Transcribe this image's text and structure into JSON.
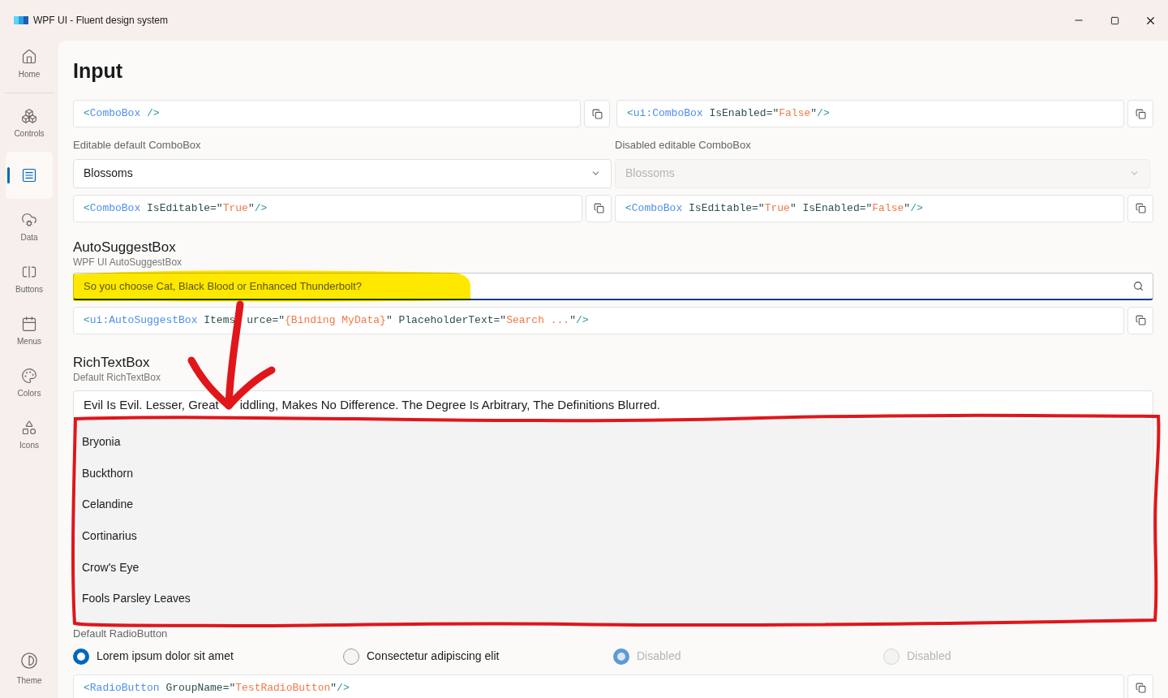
{
  "window": {
    "title": "WPF UI - Fluent design system"
  },
  "sidebar": {
    "items": [
      {
        "label": "Home",
        "selected": false
      },
      {
        "label": "Controls",
        "selected": false
      },
      {
        "selected": true
      },
      {
        "label": "Data",
        "selected": false
      },
      {
        "label": "Buttons",
        "selected": false
      },
      {
        "label": "Menus",
        "selected": false
      },
      {
        "label": "Colors",
        "selected": false
      },
      {
        "label": "Icons",
        "selected": false
      }
    ],
    "footer": {
      "label": "Theme"
    }
  },
  "page": {
    "title": "Input"
  },
  "combo_section": {
    "top_code": [
      [
        {
          "kind": "p",
          "text": "<"
        },
        {
          "kind": "t",
          "text": "ComboBox"
        },
        {
          "kind": "p",
          "text": " />"
        }
      ],
      [
        {
          "kind": "p",
          "text": "<"
        },
        {
          "kind": "t",
          "text": "ui:ComboBox"
        },
        {
          "kind": "a",
          "text": " IsEnabled=\""
        },
        {
          "kind": "v",
          "text": "False"
        },
        {
          "kind": "a",
          "text": "\""
        },
        {
          "kind": "p",
          "text": "/>"
        }
      ]
    ],
    "combos": [
      {
        "label": "Editable default ComboBox",
        "value": "Blossoms",
        "disabled": false
      },
      {
        "label": "Disabled editable ComboBox",
        "value": "Blossoms",
        "disabled": true
      }
    ],
    "bottom_code": [
      [
        {
          "kind": "p",
          "text": "<"
        },
        {
          "kind": "t",
          "text": "ComboBox"
        },
        {
          "kind": "a",
          "text": " IsEditable=\""
        },
        {
          "kind": "v",
          "text": "True"
        },
        {
          "kind": "a",
          "text": "\""
        },
        {
          "kind": "p",
          "text": "/>"
        }
      ],
      [
        {
          "kind": "p",
          "text": "<"
        },
        {
          "kind": "t",
          "text": "ComboBox"
        },
        {
          "kind": "a",
          "text": " IsEditable=\""
        },
        {
          "kind": "v",
          "text": "True"
        },
        {
          "kind": "a",
          "text": "\" IsEnabled=\""
        },
        {
          "kind": "v",
          "text": "False"
        },
        {
          "kind": "a",
          "text": "\""
        },
        {
          "kind": "p",
          "text": "/>"
        }
      ]
    ]
  },
  "autosuggest": {
    "title": "AutoSuggestBox",
    "subtitle": "WPF UI AutoSuggestBox",
    "placeholder": "So you choose Cat, Black Blood or Enhanced Thunderbolt?",
    "code": [
      {
        "kind": "p",
        "text": "<"
      },
      {
        "kind": "t",
        "text": "ui:AutoSuggestBox"
      },
      {
        "kind": "a",
        "text": " Items"
      },
      {
        "kind": "gap"
      },
      {
        "kind": "a",
        "text": "urce=\""
      },
      {
        "kind": "v",
        "text": "{Binding MyData}"
      },
      {
        "kind": "a",
        "text": "\" PlaceholderText=\""
      },
      {
        "kind": "v",
        "text": "Search ..."
      },
      {
        "kind": "a",
        "text": "\""
      },
      {
        "kind": "p",
        "text": "/>"
      }
    ]
  },
  "richtext": {
    "title": "RichTextBox",
    "subtitle": "Default RichTextBox",
    "text_parts": [
      "Evil Is Evil. Lesser, Great",
      "iddling, Makes No Difference. The Degree Is Arbitrary, The Definitions Blurred."
    ]
  },
  "suggestions": [
    "Bryonia",
    "Buckthorn",
    "Celandine",
    "Cortinarius",
    "Crow's Eye",
    "Fools Parsley Leaves"
  ],
  "radio_section": {
    "label": "Default RadioButton",
    "radios": [
      {
        "label": "Lorem ipsum dolor sit amet",
        "selected": true,
        "disabled": false
      },
      {
        "label": "Consectetur adipiscing elit",
        "selected": false,
        "disabled": false
      },
      {
        "label": "Disabled",
        "selected": true,
        "disabled": true
      },
      {
        "label": "Disabled",
        "selected": false,
        "disabled": true
      }
    ],
    "code": [
      {
        "kind": "p",
        "text": "<"
      },
      {
        "kind": "t",
        "text": "RadioButton"
      },
      {
        "kind": "a",
        "text": " GroupName=\""
      },
      {
        "kind": "v",
        "text": "TestRadioButton"
      },
      {
        "kind": "a",
        "text": "\""
      },
      {
        "kind": "p",
        "text": "/>"
      }
    ]
  },
  "annotations": [
    {
      "kind": "highlight"
    },
    {
      "kind": "arrow"
    },
    {
      "kind": "outline"
    }
  ]
}
